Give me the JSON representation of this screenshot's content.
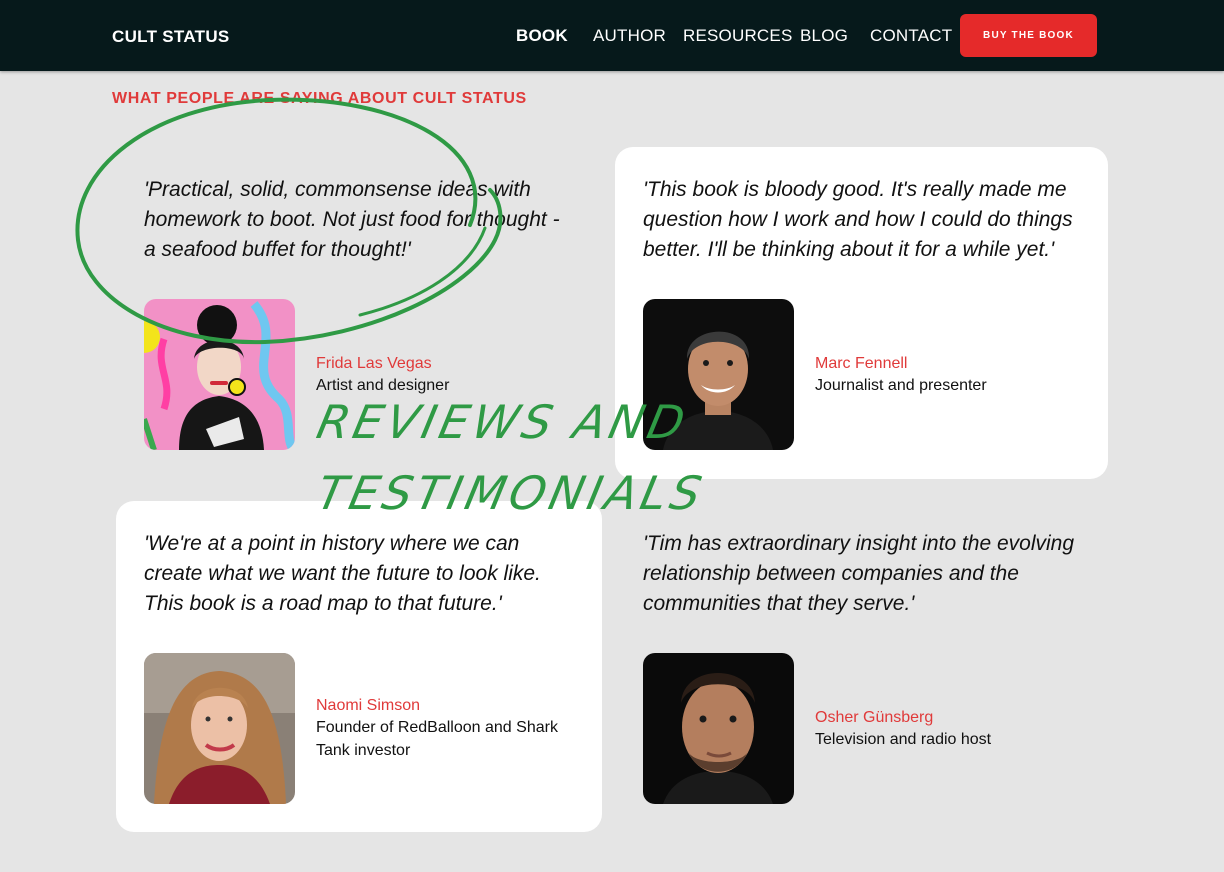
{
  "nav": {
    "brand": "CULT STATUS",
    "links": [
      "BOOK",
      "AUTHOR",
      "RESOURCES",
      "BLOG",
      "CONTACT"
    ],
    "cta": "BUY THE BOOK"
  },
  "section": {
    "title": "WHAT PEOPLE ARE SAYING ABOUT CULT STATUS"
  },
  "testimonials": [
    {
      "quote": "'Practical, solid, commonsense ideas with homework to boot. Not just food for thought - a seafood buffet for thought!'",
      "name": "Frida Las Vegas",
      "role": "Artist and designer"
    },
    {
      "quote": "'This book is bloody good. It's really made me question how I work and how I could do things better. I'll be thinking about it for a while yet.'",
      "name": "Marc Fennell",
      "role": "Journalist and presenter"
    },
    {
      "quote": "'We're at a point in history where we can create what we want the future to look like. This book is a road map to that future.'",
      "name": "Naomi Simson",
      "role": "Founder of RedBalloon and Shark Tank investor"
    },
    {
      "quote": "'Tim has extraordinary insight into the evolving relationship between companies and the communities that they serve.'",
      "name": "Osher Günsberg",
      "role": "Television and radio host"
    }
  ],
  "annotation": {
    "line1": "REVIEWS AND",
    "line2": "TESTIMONIALS",
    "color": "#2f9a45"
  },
  "colors": {
    "nav_bg": "#06191b",
    "accent": "#e52a2a",
    "page_bg": "#e5e5e5"
  }
}
